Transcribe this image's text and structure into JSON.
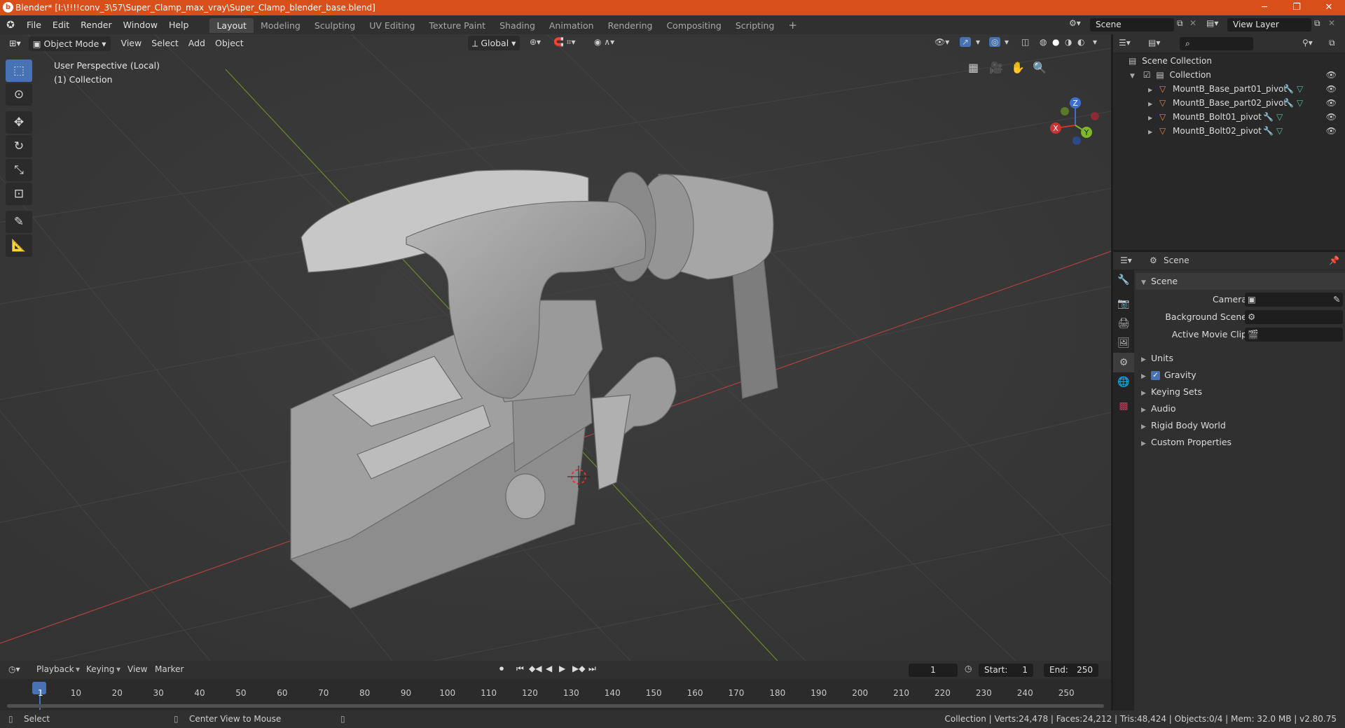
{
  "titlebar": {
    "title": "Blender* [I:\\!!!!conv_3\\57\\Super_Clamp_max_vray\\Super_Clamp_blender_base.blend]",
    "minimize": "─",
    "maximize": "❐",
    "close": "✕"
  },
  "menu": [
    "File",
    "Edit",
    "Render",
    "Window",
    "Help"
  ],
  "workspaces": [
    "Layout",
    "Modeling",
    "Sculpting",
    "UV Editing",
    "Texture Paint",
    "Shading",
    "Animation",
    "Rendering",
    "Compositing",
    "Scripting"
  ],
  "active_workspace": "Layout",
  "scene_field": "Scene",
  "viewlayer_field": "View Layer",
  "viewport": {
    "mode": "Object Mode",
    "menus": [
      "View",
      "Select",
      "Add",
      "Object"
    ],
    "transform_orientation": "Global",
    "info_line1": "User Perspective (Local)",
    "info_line2": "(1) Collection",
    "gizmo": {
      "x": "X",
      "y": "Y",
      "z": "Z"
    }
  },
  "outliner": {
    "root": "Scene Collection",
    "collection": "Collection",
    "items": [
      "MountB_Base_part01_pivot",
      "MountB_Base_part02_pivot",
      "MountB_Bolt01_pivot",
      "MountB_Bolt02_pivot"
    ]
  },
  "properties": {
    "header": "Scene",
    "panel": "Scene",
    "camera_label": "Camera",
    "background_scene_label": "Background Scene",
    "active_movie_clip_label": "Active Movie Clip",
    "sections": [
      "Units",
      "Gravity",
      "Keying Sets",
      "Audio",
      "Rigid Body World",
      "Custom Properties"
    ],
    "gravity_checked": true
  },
  "timeline": {
    "menus": [
      "Playback",
      "Keying",
      "View",
      "Marker"
    ],
    "current_frame": "1",
    "start_label": "Start:",
    "start": "1",
    "end_label": "End:",
    "end": "250",
    "ticks": [
      "1",
      "10",
      "20",
      "30",
      "40",
      "50",
      "60",
      "70",
      "80",
      "90",
      "100",
      "110",
      "120",
      "130",
      "140",
      "150",
      "160",
      "170",
      "180",
      "190",
      "200",
      "210",
      "220",
      "230",
      "240",
      "250"
    ]
  },
  "statusbar": {
    "left1": "Select",
    "left2": "Center View to Mouse",
    "stats": "Collection | Verts:24,478 | Faces:24,212 | Tris:48,424 | Objects:0/4 | Mem: 32.0 MB | v2.80.75"
  },
  "colors": {
    "accent": "#4772b3",
    "titlebar": "#d94f1a",
    "x_axis": "#c23a3a",
    "y_axis": "#7a9a2a"
  }
}
